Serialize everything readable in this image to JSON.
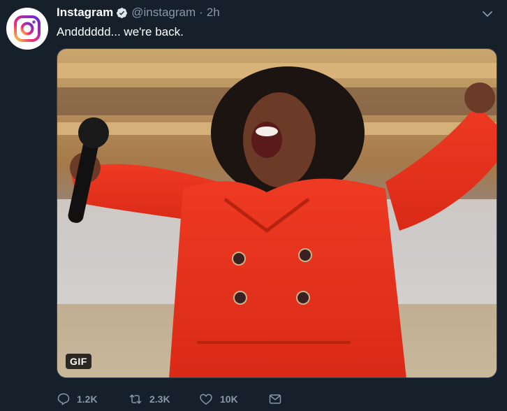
{
  "tweet": {
    "author_name": "Instagram",
    "handle": "@instagram",
    "separator": "·",
    "time": "2h",
    "text": "Andddddd... we're back.",
    "media": {
      "badge": "GIF",
      "icon": "animated-gif"
    },
    "avatar_icon": "instagram-logo"
  },
  "actions": {
    "reply": {
      "icon": "reply-icon",
      "count": "1.2K"
    },
    "retweet": {
      "icon": "retweet-icon",
      "count": "2.3K"
    },
    "like": {
      "icon": "heart-icon",
      "count": "10K"
    },
    "dm": {
      "icon": "envelope-icon"
    }
  },
  "colors": {
    "background": "#15202b",
    "secondary_text": "#8899a6",
    "verified_blue": "#1da1f2"
  }
}
